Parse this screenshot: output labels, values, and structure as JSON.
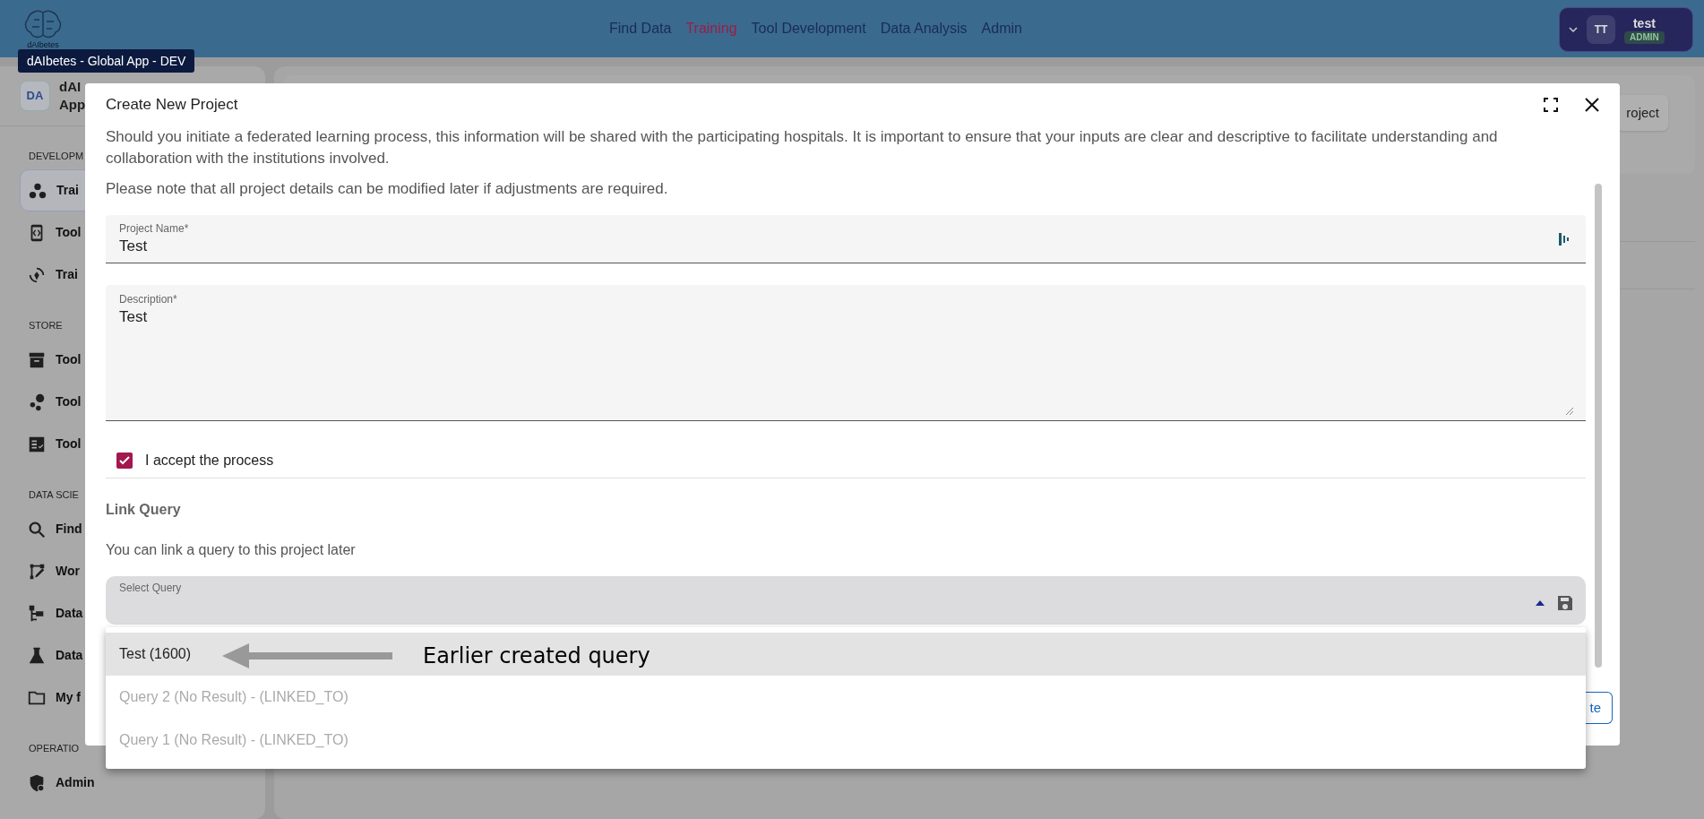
{
  "app_bar": {
    "logo_text": "dAIbetes",
    "nav": [
      {
        "label": "Find Data",
        "selected": false
      },
      {
        "label": "Training",
        "selected": true
      },
      {
        "label": "Tool Development",
        "selected": false
      },
      {
        "label": "Data Analysis",
        "selected": false
      },
      {
        "label": "Admin",
        "selected": false
      }
    ],
    "user": {
      "initials": "TT",
      "name": "test",
      "role": "ADMIN"
    }
  },
  "tooltip": "dAIbetes - Global App - DEV",
  "sidebar": {
    "avatar": "DA",
    "title_lines": [
      "dAI",
      "App"
    ],
    "sections": [
      {
        "title": "DEVELOPM",
        "items": [
          {
            "kind": "dots",
            "label": "Trai",
            "selected": true
          },
          {
            "kind": "code",
            "label": "Tool",
            "selected": false
          },
          {
            "kind": "sync",
            "label": "Trai",
            "selected": false
          }
        ]
      },
      {
        "title": "STORE",
        "items": [
          {
            "kind": "archive",
            "label": "Tool",
            "selected": false
          },
          {
            "kind": "bubbles",
            "label": "Tool",
            "selected": false
          },
          {
            "kind": "checklist",
            "label": "Tool",
            "selected": false
          }
        ]
      },
      {
        "title": "DATA SCIE",
        "items": [
          {
            "kind": "search",
            "label": "Find",
            "selected": false
          },
          {
            "kind": "flow",
            "label": "Wor",
            "selected": false
          },
          {
            "kind": "tree",
            "label": "Data",
            "selected": false
          },
          {
            "kind": "flask",
            "label": "Data",
            "selected": false
          },
          {
            "kind": "folder",
            "label": "My f",
            "selected": false
          }
        ]
      },
      {
        "title": "OPERATIO",
        "items": [
          {
            "kind": "shield",
            "label": "Admin",
            "selected": false
          }
        ]
      }
    ]
  },
  "main": {
    "button": "roject"
  },
  "dialog": {
    "title": "Create New Project",
    "paragraphs": [
      "Should you initiate a federated learning process, this information will be shared with the participating hospitals. It is important to ensure that your inputs are clear and descriptive to facilitate understanding and collaboration with the institutions involved.",
      "Please note that all project details can be modified later if adjustments are required."
    ],
    "project_name": {
      "label": "Project Name*",
      "value": "Test"
    },
    "description": {
      "label": "Description*",
      "value": "Test"
    },
    "accept": {
      "label": "I accept the process",
      "checked": true
    },
    "link_query": {
      "heading": "Link Query",
      "hint": "You can link a query to this project later",
      "select_label": "Select Query",
      "expanded": true,
      "options": [
        {
          "label": "Test (1600)",
          "selected": true,
          "disabled": false
        },
        {
          "label": "Query 2 (No Result) - (LINKED_TO)",
          "selected": false,
          "disabled": true
        },
        {
          "label": "Query 1 (No Result) - (LINKED_TO)",
          "selected": false,
          "disabled": true
        }
      ]
    },
    "footer_button": "te"
  },
  "annotation": {
    "text": "Earlier created query"
  }
}
